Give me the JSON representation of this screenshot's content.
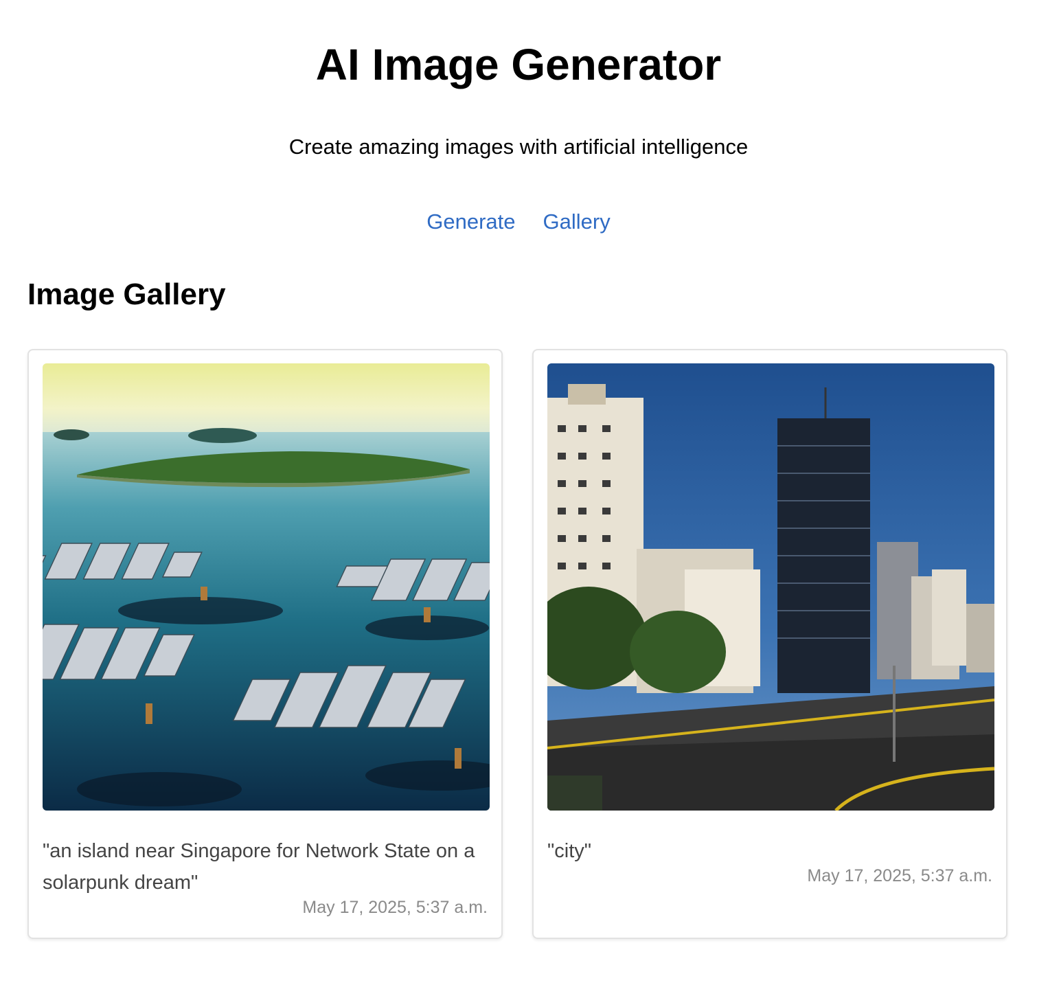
{
  "header": {
    "title": "AI Image Generator",
    "subtitle": "Create amazing images with artificial intelligence"
  },
  "nav": {
    "items": [
      {
        "label": "Generate"
      },
      {
        "label": "Gallery"
      }
    ]
  },
  "gallery": {
    "title": "Image Gallery",
    "cards": [
      {
        "prompt": "\"an island near Singapore for Network State on a solarpunk dream\"",
        "date": "May 17, 2025, 5:37 a.m.",
        "image": "solarpunk-island-solar-panels-image"
      },
      {
        "prompt": "\"city\"",
        "date": "May 17, 2025, 5:37 a.m.",
        "image": "city-street-skyscrapers-image"
      }
    ]
  }
}
